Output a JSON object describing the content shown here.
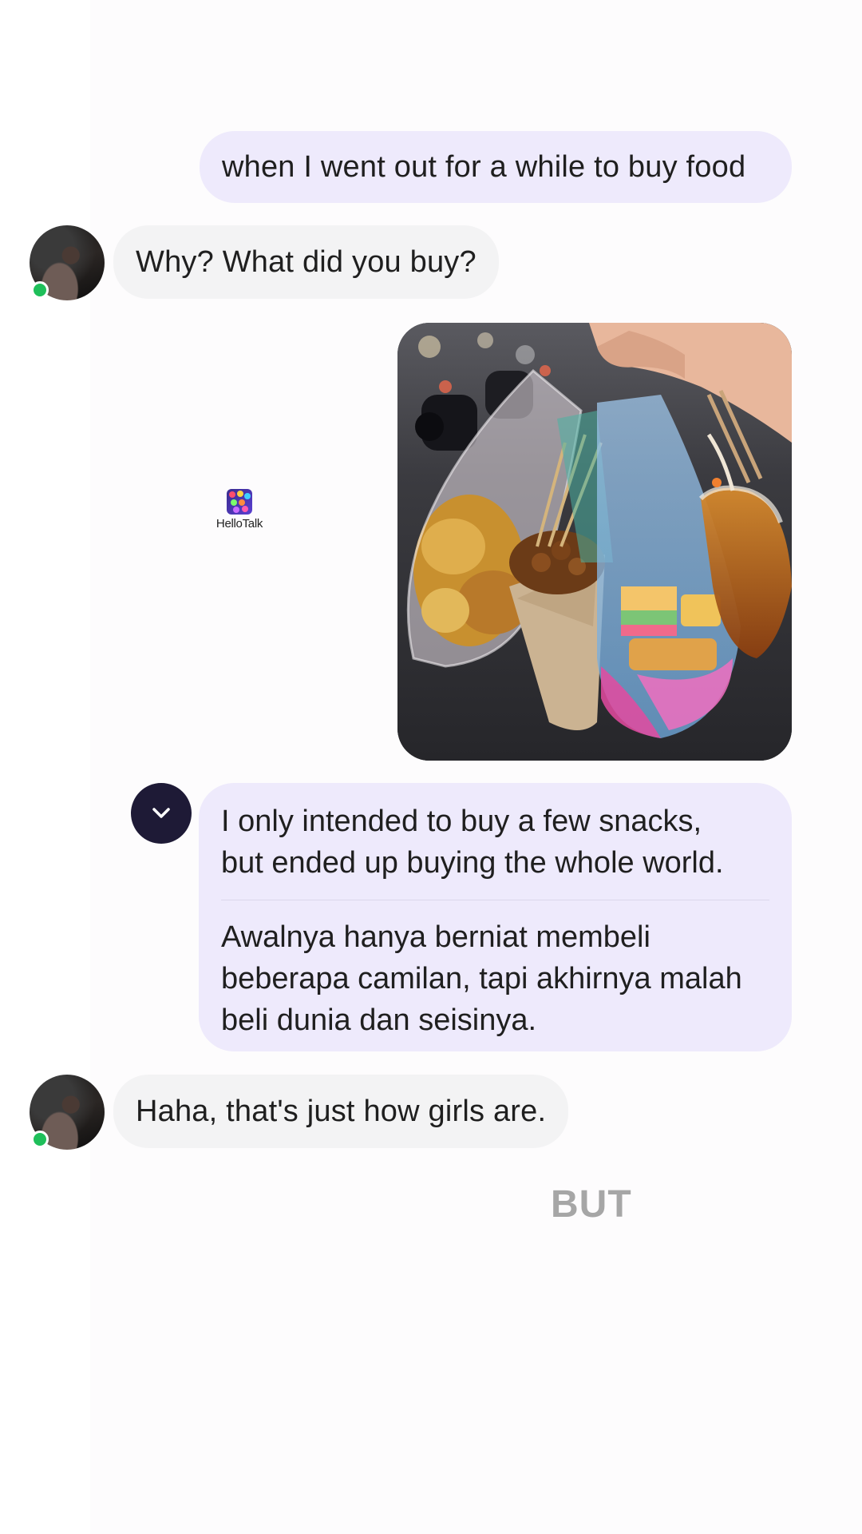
{
  "messages": {
    "m1": {
      "text": "when I went out for a while to buy food"
    },
    "m2": {
      "text": "Why? What did you buy?"
    },
    "m3": {
      "image_desc": "food-bags-photo"
    },
    "m4": {
      "original_line1": "I only intended to buy a few snacks,",
      "original_line2": "but ended up buying the whole world.",
      "translated_line1": "Awalnya hanya berniat membeli",
      "translated_line2": "beberapa camilan, tapi akhirnya malah",
      "translated_line3": "beli dunia dan seisinya."
    },
    "m5": {
      "text": "Haha, that's just how girls are."
    }
  },
  "watermark": {
    "brand": "HelloTalk"
  },
  "caption": {
    "text": "BUT"
  },
  "colors": {
    "sent_bubble": "#eeeafc",
    "received_bubble": "#f3f3f4",
    "translate_button": "#1e1a36",
    "online_dot": "#1fbf5a",
    "caption": "#a6a6a6"
  },
  "icons": {
    "translate_toggle": "chevron-down-icon",
    "online_status": "online-dot-icon"
  }
}
